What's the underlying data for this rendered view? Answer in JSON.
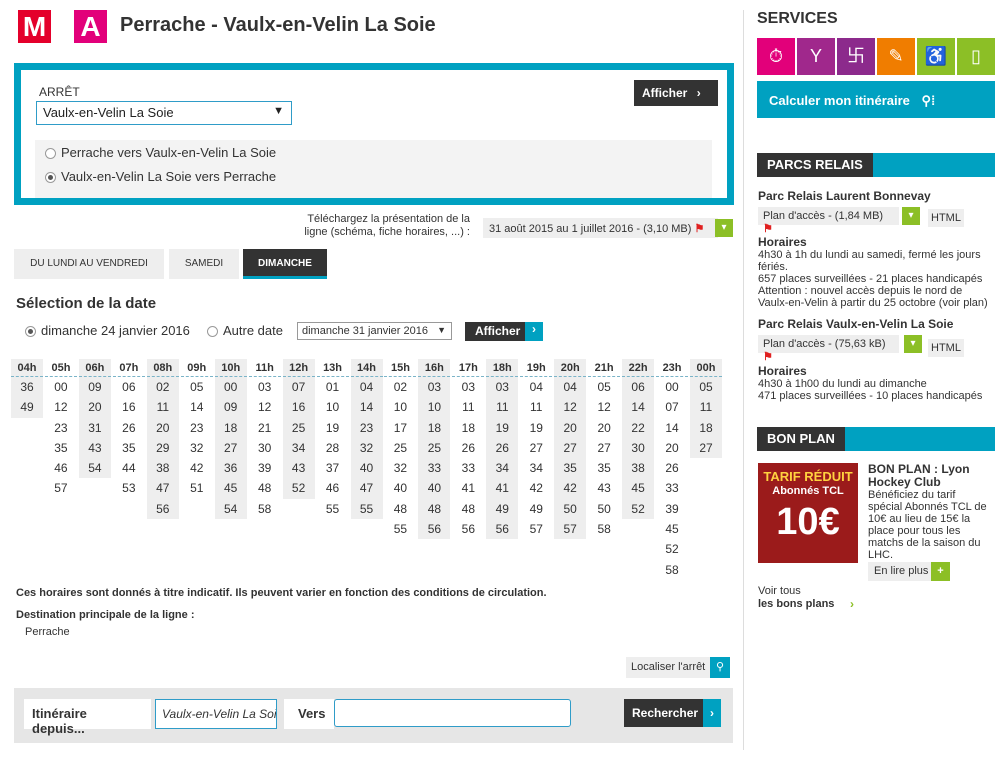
{
  "header": {
    "badge_m": "M",
    "badge_a": "A",
    "title": "Perrache - Vaulx-en-Velin La Soie"
  },
  "stop": {
    "label": "ARRÊT",
    "selected": "Vaulx-en-Velin La Soie",
    "afficher": "Afficher",
    "directions": [
      {
        "label": "Perrache vers Vaulx-en-Velin La Soie",
        "checked": false
      },
      {
        "label": "Vaulx-en-Velin La Soie vers Perrache",
        "checked": true
      }
    ]
  },
  "download": {
    "text": "Téléchargez la présentation de la ligne (schéma, fiche horaires, ...) :",
    "file": "31 août 2015 au 1 juillet 2016 - (3,10 MB)"
  },
  "tabs": [
    {
      "label": "DU LUNDI AU VENDREDI",
      "active": false
    },
    {
      "label": "SAMEDI",
      "active": false
    },
    {
      "label": "DIMANCHE",
      "active": true
    }
  ],
  "date_selection": {
    "title": "Sélection de la date",
    "option1": "dimanche 24 janvier 2016",
    "option2": "Autre date",
    "select_value": "dimanche 31 janvier 2016",
    "afficher": "Afficher"
  },
  "timetable": [
    {
      "hour": "04h",
      "minutes": [
        "36",
        "49"
      ]
    },
    {
      "hour": "05h",
      "minutes": [
        "00",
        "12",
        "23",
        "35",
        "46",
        "57"
      ]
    },
    {
      "hour": "06h",
      "minutes": [
        "09",
        "20",
        "31",
        "43",
        "54"
      ]
    },
    {
      "hour": "07h",
      "minutes": [
        "06",
        "16",
        "26",
        "35",
        "44",
        "53"
      ]
    },
    {
      "hour": "08h",
      "minutes": [
        "02",
        "11",
        "20",
        "29",
        "38",
        "47",
        "56"
      ]
    },
    {
      "hour": "09h",
      "minutes": [
        "05",
        "14",
        "23",
        "32",
        "42",
        "51"
      ]
    },
    {
      "hour": "10h",
      "minutes": [
        "00",
        "09",
        "18",
        "27",
        "36",
        "45",
        "54"
      ]
    },
    {
      "hour": "11h",
      "minutes": [
        "03",
        "12",
        "21",
        "30",
        "39",
        "48",
        "58"
      ]
    },
    {
      "hour": "12h",
      "minutes": [
        "07",
        "16",
        "25",
        "34",
        "43",
        "52"
      ]
    },
    {
      "hour": "13h",
      "minutes": [
        "01",
        "10",
        "19",
        "28",
        "37",
        "46",
        "55"
      ]
    },
    {
      "hour": "14h",
      "minutes": [
        "04",
        "14",
        "23",
        "32",
        "40",
        "47",
        "55"
      ]
    },
    {
      "hour": "15h",
      "minutes": [
        "02",
        "10",
        "17",
        "25",
        "32",
        "40",
        "48",
        "55"
      ]
    },
    {
      "hour": "16h",
      "minutes": [
        "03",
        "10",
        "18",
        "25",
        "33",
        "40",
        "48",
        "56"
      ]
    },
    {
      "hour": "17h",
      "minutes": [
        "03",
        "11",
        "18",
        "26",
        "33",
        "41",
        "48",
        "56"
      ]
    },
    {
      "hour": "18h",
      "minutes": [
        "03",
        "11",
        "19",
        "26",
        "34",
        "41",
        "49",
        "56"
      ]
    },
    {
      "hour": "19h",
      "minutes": [
        "04",
        "11",
        "19",
        "27",
        "34",
        "42",
        "49",
        "57"
      ]
    },
    {
      "hour": "20h",
      "minutes": [
        "04",
        "12",
        "20",
        "27",
        "35",
        "42",
        "50",
        "57"
      ]
    },
    {
      "hour": "21h",
      "minutes": [
        "05",
        "12",
        "20",
        "27",
        "35",
        "43",
        "50",
        "58"
      ]
    },
    {
      "hour": "22h",
      "minutes": [
        "06",
        "14",
        "22",
        "30",
        "38",
        "45",
        "52"
      ]
    },
    {
      "hour": "23h",
      "minutes": [
        "00",
        "07",
        "14",
        "20",
        "26",
        "33",
        "39",
        "45",
        "52",
        "58"
      ]
    },
    {
      "hour": "00h",
      "minutes": [
        "05",
        "11",
        "18",
        "27"
      ]
    }
  ],
  "note": "Ces horaires sont donnés à titre indicatif. Ils peuvent varier en fonction des conditions de circulation.",
  "destination": {
    "label": "Destination principale de la ligne :",
    "value": "Perrache"
  },
  "localiser": "Localiser l'arrêt",
  "itinerary": {
    "label": "Itinéraire depuis...",
    "from": "Vaulx-en-Velin La Soie",
    "vers": "Vers",
    "to": "",
    "search": "Rechercher"
  },
  "services": {
    "title": "SERVICES",
    "icons": [
      {
        "name": "timer-icon",
        "glyph": "⏱",
        "color": "#e2007a"
      },
      {
        "name": "route-icon",
        "glyph": "Y",
        "color": "#a0288c"
      },
      {
        "name": "network-icon",
        "glyph": "卐",
        "color": "#8c2a8c"
      },
      {
        "name": "ticket-icon",
        "glyph": "✎",
        "color": "#f07d00"
      },
      {
        "name": "wheelchair-icon",
        "glyph": "♿",
        "color": "#8cbf26"
      },
      {
        "name": "mobile-icon",
        "glyph": "▯",
        "color": "#8cbf26"
      }
    ],
    "calc": "Calculer mon itinéraire"
  },
  "parcs": {
    "title": "PARCS RELAIS",
    "items": [
      {
        "name": "Parc Relais Laurent Bonnevay",
        "plan": "Plan d'accès - (1,84 MB)",
        "html": "HTML",
        "horaires_label": "Horaires",
        "horaires": "4h30 à 1h du lundi au samedi, fermé les jours fériés.",
        "places": "657 places surveillées - 21 places handicapés",
        "attention": "Attention : nouvel accès depuis le nord de Vaulx-en-Velin à partir du 25 octobre (voir plan)"
      },
      {
        "name": "Parc Relais Vaulx-en-Velin La Soie",
        "plan": "Plan d'accès - (75,63 kB)",
        "html": "HTML",
        "horaires_label": "Horaires",
        "horaires": "4h30 à 1h00 du lundi au dimanche",
        "places": "471 places surveillées - 10 places handicapés"
      }
    ]
  },
  "bonplan": {
    "title": "BON PLAN",
    "img_line1": "TARIF RÉDUIT",
    "img_line2": "Abonnés TCL",
    "img_price": "10€",
    "heading": "BON PLAN : Lyon Hockey Club",
    "text": "Bénéficiez du tarif spécial Abonnés TCL de 10€ au lieu de 15€ la place pour tous les matchs de la saison du LHC.",
    "lire": "En lire plus",
    "voir1": "Voir tous",
    "voir2": "les bons plans"
  }
}
